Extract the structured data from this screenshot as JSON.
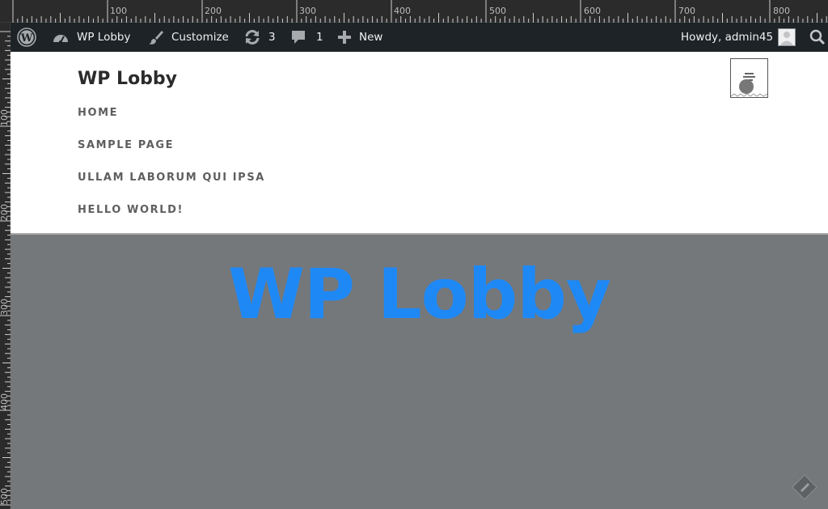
{
  "ruler": {
    "top_labels": [
      "100",
      "200",
      "300",
      "400",
      "500",
      "600",
      "700",
      "800"
    ],
    "left_labels": [
      "100",
      "200",
      "300",
      "400",
      "500"
    ]
  },
  "adminbar": {
    "site_name": "WP Lobby",
    "customize": "Customize",
    "updates_count": "3",
    "comments_count": "1",
    "new_label": "New",
    "greeting": "Howdy, admin45"
  },
  "site": {
    "title": "WP Lobby",
    "nav": [
      "Home",
      "Sample Page",
      "Ullam laborum qui ipsa",
      "Hello world!"
    ]
  },
  "hero": {
    "title": "WP Lobby"
  },
  "colors": {
    "adminbar_bg": "#1d2327",
    "hero_bg": "#75787b",
    "hero_title": "#1e88f5"
  }
}
